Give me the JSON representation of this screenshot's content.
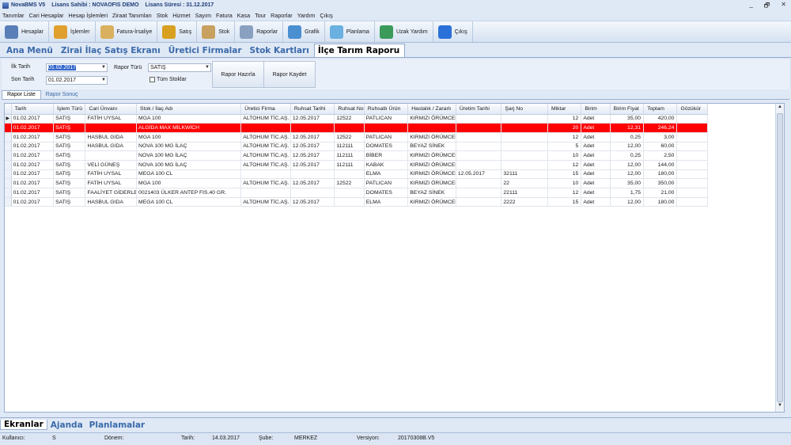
{
  "titlebar": {
    "app": "NovaBMS V5",
    "license_owner": "Lisans Sahibi : NOVAOFIS DEMO",
    "license_period": "Lisans Süresi : 31.12.2017",
    "minimize": "_",
    "restore": "🗗",
    "close": "✕"
  },
  "menu": [
    "Tanımlar",
    "Cari Hesaplar",
    "Hesap İşlemleri",
    "Ziraat Tanımları",
    "Stok",
    "Hizmet",
    "Sayım",
    "Fatura",
    "Kasa",
    "Tour",
    "Raporlar",
    "Yardım",
    "Çıkış"
  ],
  "toolbar": [
    {
      "label": "Hesaplar",
      "icon": "accounts-icon",
      "color": "#5a7fb8"
    },
    {
      "label": "İşlemler",
      "icon": "operations-icon",
      "color": "#e0a030"
    },
    {
      "label": "Fatura-İrsaliye",
      "icon": "invoice-icon",
      "color": "#d9b060"
    },
    {
      "label": "Satış",
      "icon": "sales-icon",
      "color": "#d8a020"
    },
    {
      "label": "Stok",
      "icon": "stock-icon",
      "color": "#c8a060"
    },
    {
      "label": "Raporlar",
      "icon": "reports-icon",
      "color": "#8aa0c0"
    },
    {
      "label": "Grafik",
      "icon": "chart-icon",
      "color": "#4a90d0"
    },
    {
      "label": "Planlama",
      "icon": "planning-icon",
      "color": "#6ab0e0"
    },
    {
      "label": "Uzak Yardım",
      "icon": "remote-help-icon",
      "color": "#3a9a5a"
    },
    {
      "label": "Çıkış",
      "icon": "exit-icon",
      "color": "#2a70d8"
    }
  ],
  "tabs": [
    "Ana Menü",
    "Zirai İlaç Satış Ekranı",
    "Üretici Firmalar",
    "Stok Kartları",
    "İlçe Tarım Raporu"
  ],
  "active_tab": 4,
  "filters": {
    "start_label": "İlk Tarih",
    "start_value": "01.02.2017",
    "end_label": "Son Tarih",
    "end_value": "01.02.2017",
    "type_label": "Rapor Türü",
    "type_value": "SATIŞ",
    "all_stocks_label": "Tüm Stoklar",
    "prepare_button": "Rapor Hazırla",
    "save_button": "Rapor Kaydet"
  },
  "subtabs": [
    "Rapor Liste",
    "Rapor Sonuç"
  ],
  "grid": {
    "columns": [
      "Tarih",
      "İşlem Türü",
      "Cari Ünvanı",
      "Stok / İlaç Adı",
      "Üretici Firma",
      "Ruhsat Tarihi",
      "Ruhsat No",
      "Ruhsatlı Ürün",
      "Hastalık / Zararlı",
      "Üretim Tarihi",
      "Şarj No",
      "Miktar",
      "Birim",
      "Birim Fiyat",
      "Toplam",
      "Gözükür"
    ],
    "rows": [
      [
        "01.02.2017",
        "SATIŞ",
        "FATİH UYSAL",
        "MGA 100",
        "ALTOHUM TİC.AŞ.",
        "12.05.2017",
        "12522",
        "PATLICAN",
        "KIRMIZI ÖRÜMCEI",
        "",
        "",
        "12",
        "Adet",
        "35,00",
        "420,00",
        ""
      ],
      [
        "01.02.2017",
        "SATIŞ",
        "",
        "ALGİDA MAX MİLKWİCH",
        "",
        "",
        "",
        "",
        "",
        "",
        "",
        "20",
        "Adet",
        "12,31",
        "246,24",
        ""
      ],
      [
        "01.02.2017",
        "SATIŞ",
        "HASBUL GIDA",
        "MGA 100",
        "ALTOHUM TİC.AŞ.",
        "12.05.2017",
        "12522",
        "PATLICAN",
        "KIRMIZI ÖRÜMCEI",
        "",
        "",
        "12",
        "Adet",
        "0,25",
        "3,00",
        ""
      ],
      [
        "01.02.2017",
        "SATIŞ",
        "HASBUL GIDA",
        "NOVA 100 MG İLAÇ",
        "ALTOHUM TİC.AŞ.",
        "12.05.2017",
        "112111",
        "DOMATES",
        "BEYAZ SİNEK",
        "",
        "",
        "5",
        "Adet",
        "12,00",
        "60,00",
        ""
      ],
      [
        "01.02.2017",
        "SATIŞ",
        "",
        "NOVA 100 MG İLAÇ",
        "ALTOHUM TİC.AŞ.",
        "12.05.2017",
        "112111",
        "BİBER",
        "KIRMIZI ÖRÜMCEI",
        "",
        "",
        "10",
        "Adet",
        "0,25",
        "2,50",
        ""
      ],
      [
        "01.02.2017",
        "SATIŞ",
        "VELİ GÜNEŞ",
        "NOVA 100 MG İLAÇ",
        "ALTOHUM TİC.AŞ.",
        "12.05.2017",
        "112111",
        "KABAK",
        "KIRMIZI ÖRÜMCEI",
        "",
        "",
        "12",
        "Adet",
        "12,00",
        "144,00",
        ""
      ],
      [
        "01.02.2017",
        "SATIŞ",
        "FATİH UYSAL",
        "MEGA 100 CL",
        "",
        "",
        "",
        "ELMA",
        "KIRMIZI ÖRÜMCEI",
        "12.05.2017",
        "32111",
        "15",
        "Adet",
        "12,00",
        "180,00",
        ""
      ],
      [
        "01.02.2017",
        "SATIŞ",
        "FATİH UYSAL",
        "MGA 100",
        "ALTOHUM TİC.AŞ.",
        "12.05.2017",
        "12522",
        "PATLICAN",
        "KIRMIZI ÖRÜMCEI",
        "",
        "22",
        "10",
        "Adet",
        "35,00",
        "350,00",
        ""
      ],
      [
        "01.02.2017",
        "SATIŞ",
        "FAALİYET GİDERLEİ",
        "0021403 ÜLKER ANTEP FIS.40 GR.",
        "",
        "",
        "",
        "DOMATES",
        "BEYAZ SİNEK",
        "",
        "22111",
        "12",
        "Adet",
        "1,75",
        "21,00",
        ""
      ],
      [
        "01.02.2017",
        "SATIŞ",
        "HASBUL GIDA",
        "MEGA 100 CL",
        "ALTOHUM TİC.AŞ.",
        "12.05.2017",
        "",
        "ELMA",
        "KIRMIZI ÖRÜMCEI",
        "",
        "2222",
        "15",
        "Adet",
        "12,00",
        "180,00",
        ""
      ]
    ],
    "highlighted_row": 1,
    "current_row": 0
  },
  "bottom_tabs": [
    "Ekranlar",
    "Ajanda",
    "Planlamalar"
  ],
  "status": {
    "user_label": "Kullanıcı:",
    "user_value": "S",
    "period_label": "Dönem:",
    "period_value": "",
    "date_label": "Tarih:",
    "date_value": "14.03.2017",
    "branch_label": "Şube:",
    "branch_value": "MERKEZ",
    "version_label": "Versiyon:",
    "version_value": "20170308B.V5"
  }
}
